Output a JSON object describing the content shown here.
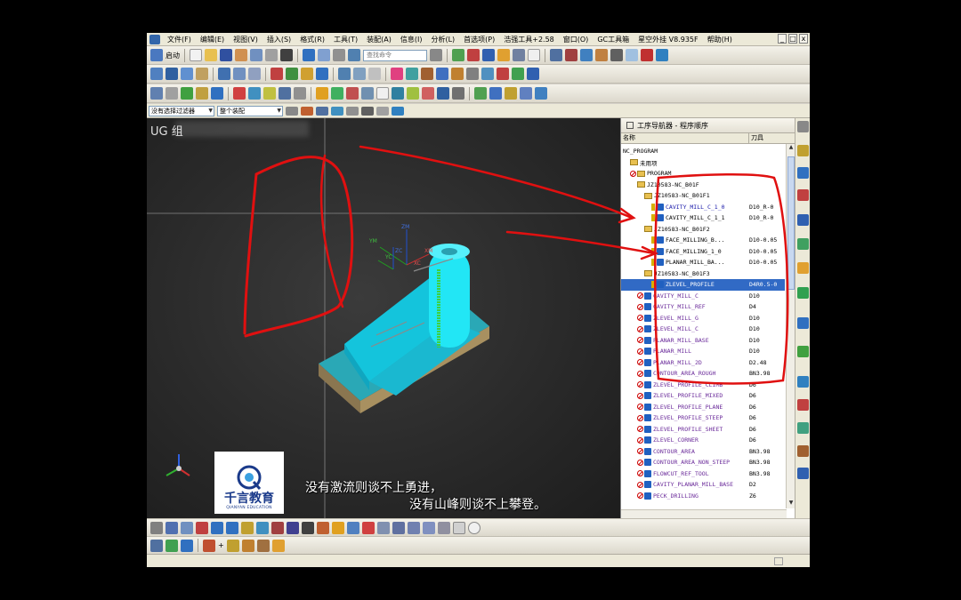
{
  "menubar": {
    "items": [
      "文件(F)",
      "编辑(E)",
      "视图(V)",
      "插入(S)",
      "格式(R)",
      "工具(T)",
      "装配(A)",
      "信息(I)",
      "分析(L)",
      "首选项(P)",
      "浩强工具+2.58",
      "窗口(O)",
      "GC工具箱",
      "星空外挂 V8.935F",
      "帮助(H)"
    ],
    "win_min": "_",
    "win_max": "□",
    "win_close": "x"
  },
  "toolbar": {
    "start_label": "启动",
    "search_placeholder": "查找命令"
  },
  "filterbar": {
    "selection_filter": "没有选择过滤器",
    "scope": "整个装配"
  },
  "viewport": {
    "title": "UG 组",
    "axis_labels": {
      "zm": "ZM",
      "ym": "YM",
      "xm": "XM",
      "zc": "ZC",
      "yc": "YC",
      "xc": "XC"
    }
  },
  "navigator": {
    "title": "工序导航器 - 程序顺序",
    "col_name": "名称",
    "col_tool": "刀具",
    "rows": [
      {
        "name": "NC_PROGRAM",
        "tool": "",
        "kind": "root",
        "indent": 0,
        "status": "none",
        "color": "black"
      },
      {
        "name": "未用项",
        "tool": "",
        "kind": "folder",
        "indent": 1,
        "status": "none",
        "color": "black"
      },
      {
        "name": "PROGRAM",
        "tool": "",
        "kind": "folder",
        "indent": 1,
        "status": "x",
        "color": "black"
      },
      {
        "name": "JZ10583-NC_B01F",
        "tool": "",
        "kind": "folder",
        "indent": 2,
        "status": "ok",
        "color": "black"
      },
      {
        "name": "JZ10583-NC_B01F1",
        "tool": "",
        "kind": "folder",
        "indent": 3,
        "status": "ok",
        "color": "black"
      },
      {
        "name": "CAVITY_MILL_C_1_0",
        "tool": "D10_R-0",
        "kind": "op",
        "indent": 4,
        "status": "ok",
        "color": "blue"
      },
      {
        "name": "CAVITY_MILL_C_1_1",
        "tool": "D10_R-0",
        "kind": "op",
        "indent": 4,
        "status": "ok",
        "color": "black"
      },
      {
        "name": "JZ10583-NC_B01F2",
        "tool": "",
        "kind": "folder",
        "indent": 3,
        "status": "ok",
        "color": "black"
      },
      {
        "name": "FACE_MILLING_B...",
        "tool": "D10-0.05",
        "kind": "op",
        "indent": 4,
        "status": "ok",
        "color": "black"
      },
      {
        "name": "FACE_MILLING_1_0",
        "tool": "D10-0.05",
        "kind": "op",
        "indent": 4,
        "status": "ok",
        "color": "black"
      },
      {
        "name": "PLANAR_MILL_BA...",
        "tool": "D10-0.05",
        "kind": "op",
        "indent": 4,
        "status": "ok",
        "color": "black"
      },
      {
        "name": "JZ10583-NC_B01F3",
        "tool": "",
        "kind": "folder",
        "indent": 3,
        "status": "ok",
        "color": "black"
      },
      {
        "name": "ZLEVEL_PROFILE",
        "tool": "D4R0.5-0",
        "kind": "op",
        "indent": 4,
        "status": "ok",
        "color": "white",
        "selected": true
      },
      {
        "name": "CAVITY_MILL_C",
        "tool": "D10",
        "kind": "op",
        "indent": 2,
        "status": "x",
        "color": "purple"
      },
      {
        "name": "CAVITY_MILL_REF",
        "tool": "D4",
        "kind": "op",
        "indent": 2,
        "status": "x",
        "color": "purple"
      },
      {
        "name": "ZLEVEL_MILL_G",
        "tool": "D10",
        "kind": "op",
        "indent": 2,
        "status": "x",
        "color": "purple"
      },
      {
        "name": "ZLEVEL_MILL_C",
        "tool": "D10",
        "kind": "op",
        "indent": 2,
        "status": "x",
        "color": "purple"
      },
      {
        "name": "PLANAR_MILL_BASE",
        "tool": "D10",
        "kind": "op",
        "indent": 2,
        "status": "x",
        "color": "purple"
      },
      {
        "name": "PLANAR_MILL",
        "tool": "D10",
        "kind": "op",
        "indent": 2,
        "status": "x",
        "color": "purple"
      },
      {
        "name": "PLANAR_MILL_2D",
        "tool": "D2.48",
        "kind": "op",
        "indent": 2,
        "status": "x",
        "color": "purple"
      },
      {
        "name": "CONTOUR_AREA_ROUGH",
        "tool": "BN3.98",
        "kind": "op",
        "indent": 2,
        "status": "x",
        "color": "purple"
      },
      {
        "name": "ZLEVEL_PROFILE_CLIMB",
        "tool": "D6",
        "kind": "op",
        "indent": 2,
        "status": "x",
        "color": "purple"
      },
      {
        "name": "ZLEVEL_PROFILE_MIXED",
        "tool": "D6",
        "kind": "op",
        "indent": 2,
        "status": "x",
        "color": "purple"
      },
      {
        "name": "ZLEVEL_PROFILE_PLANE",
        "tool": "D6",
        "kind": "op",
        "indent": 2,
        "status": "x",
        "color": "purple"
      },
      {
        "name": "ZLEVEL_PROFILE_STEEP",
        "tool": "D6",
        "kind": "op",
        "indent": 2,
        "status": "x",
        "color": "purple"
      },
      {
        "name": "ZLEVEL_PROFILE_SHEET",
        "tool": "D6",
        "kind": "op",
        "indent": 2,
        "status": "x",
        "color": "purple"
      },
      {
        "name": "ZLEVEL_CORNER",
        "tool": "D6",
        "kind": "op",
        "indent": 2,
        "status": "x",
        "color": "purple"
      },
      {
        "name": "CONTOUR_AREA",
        "tool": "BN3.98",
        "kind": "op",
        "indent": 2,
        "status": "x",
        "color": "purple"
      },
      {
        "name": "CONTOUR_AREA_NON_STEEP",
        "tool": "BN3.98",
        "kind": "op",
        "indent": 2,
        "status": "x",
        "color": "purple"
      },
      {
        "name": "FLOWCUT_REF_TOOL",
        "tool": "BN3.98",
        "kind": "op",
        "indent": 2,
        "status": "x",
        "color": "purple"
      },
      {
        "name": "CAVITY_PLANAR_MILL_BASE",
        "tool": "D2",
        "kind": "op",
        "indent": 2,
        "status": "x",
        "color": "purple"
      },
      {
        "name": "PECK_DRILLING",
        "tool": "Z6",
        "kind": "op",
        "indent": 2,
        "status": "x",
        "color": "purple"
      }
    ]
  },
  "logo": {
    "name": "千言教育",
    "sub": "QIANYAN EDUCATION"
  },
  "subtitles": {
    "line1": "没有激流则谈不上勇进，",
    "line2": "没有山峰则谈不上攀登。"
  },
  "colors": {
    "part_top": "#22e6f5",
    "part_side": "#14a9c4",
    "base_top": "#2aa8b6",
    "base_side": "#8a7650",
    "annotation": "#e01010",
    "selected_row": "#316ac5"
  }
}
